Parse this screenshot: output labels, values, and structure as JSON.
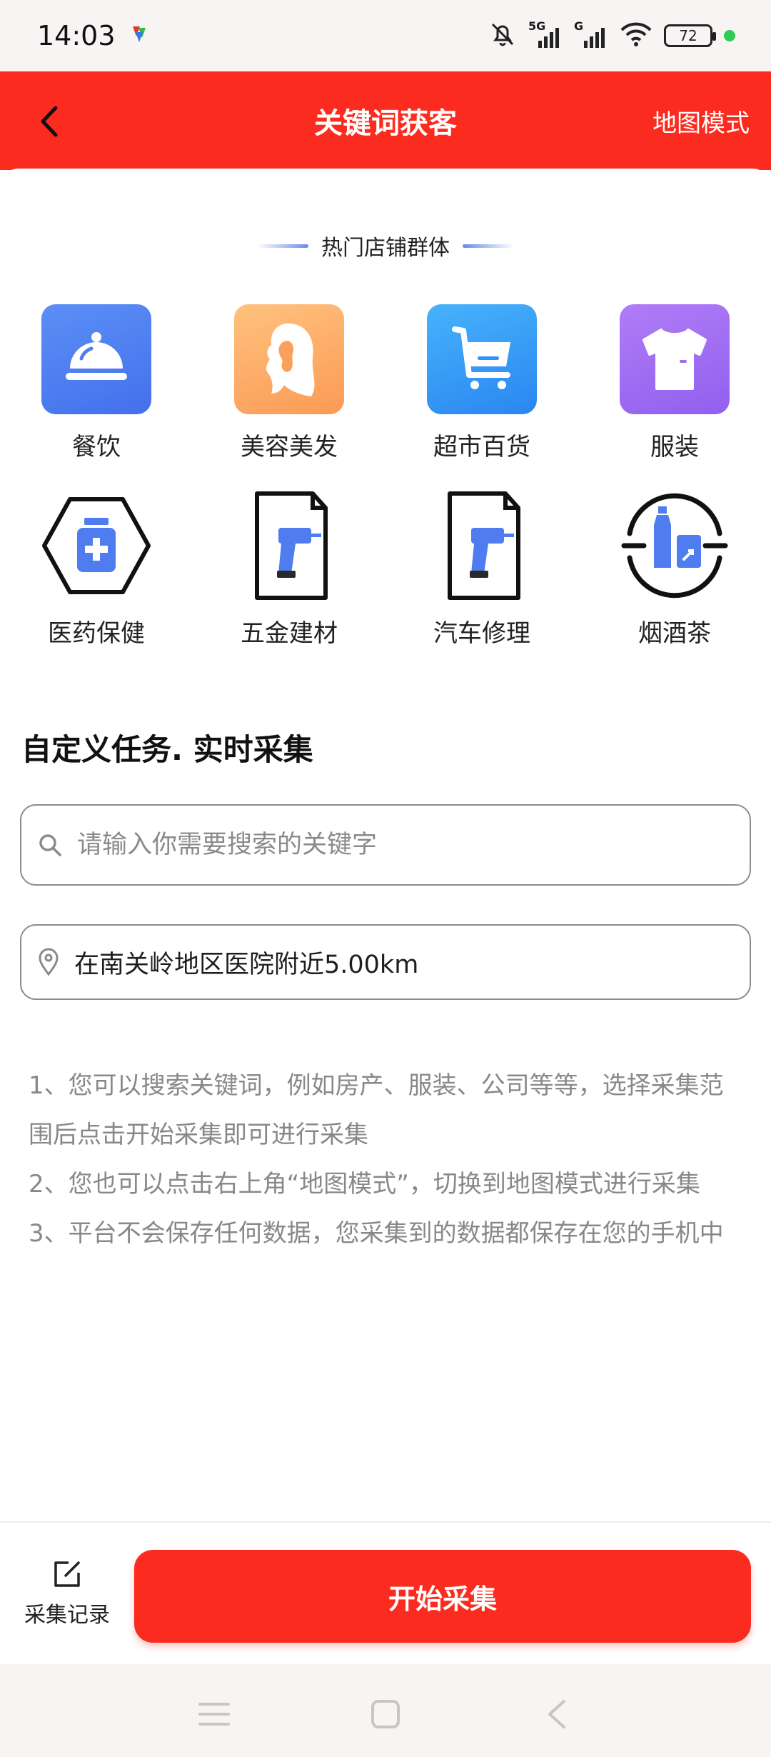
{
  "status": {
    "time": "14:03",
    "battery": "72",
    "network_1": "5G",
    "network_2": "G",
    "colors": {
      "online_dot": "#2ecc52"
    }
  },
  "header": {
    "title": "关键词获客",
    "map_mode": "地图模式",
    "back_icon": "chevron-left-icon",
    "colors": {
      "background": "#fb2c1f",
      "text": "#ffffff"
    }
  },
  "hot_section": {
    "title": "热门店铺群体",
    "categories": [
      {
        "label": "餐饮",
        "icon": "food-dome-icon",
        "color": "#4f7df0"
      },
      {
        "label": "美容美发",
        "icon": "hair-profile-icon",
        "color": "#fba05b"
      },
      {
        "label": "超市百货",
        "icon": "shopping-cart-icon",
        "color": "#2f93f5"
      },
      {
        "label": "服装",
        "icon": "tshirt-icon",
        "color": "#9f6bf0"
      },
      {
        "label": "医药保健",
        "icon": "medicine-bottle-icon",
        "color": "#4f7df0"
      },
      {
        "label": "五金建材",
        "icon": "drill-icon",
        "color": "#4f7df0"
      },
      {
        "label": "汽车修理",
        "icon": "drill-icon",
        "color": "#4f7df0"
      },
      {
        "label": "烟酒茶",
        "icon": "bottle-icon",
        "color": "#4f7df0"
      }
    ]
  },
  "task": {
    "title": "自定义任务. 实时采集",
    "search_placeholder": "请输入你需要搜索的关键字",
    "location": "在南关岭地区医院附近5.00km"
  },
  "tips": [
    "1、您可以搜索关键词，例如房产、服装、公司等等，选择采集范围后点击开始采集即可进行采集",
    " 2、您也可以点击右上角“地图模式”，切换到地图模式进行采集",
    " 3、平台不会保存任何数据，您采集到的数据都保存在您的手机中"
  ],
  "bottom": {
    "records_label": "采集记录",
    "start_label": "开始采集"
  }
}
